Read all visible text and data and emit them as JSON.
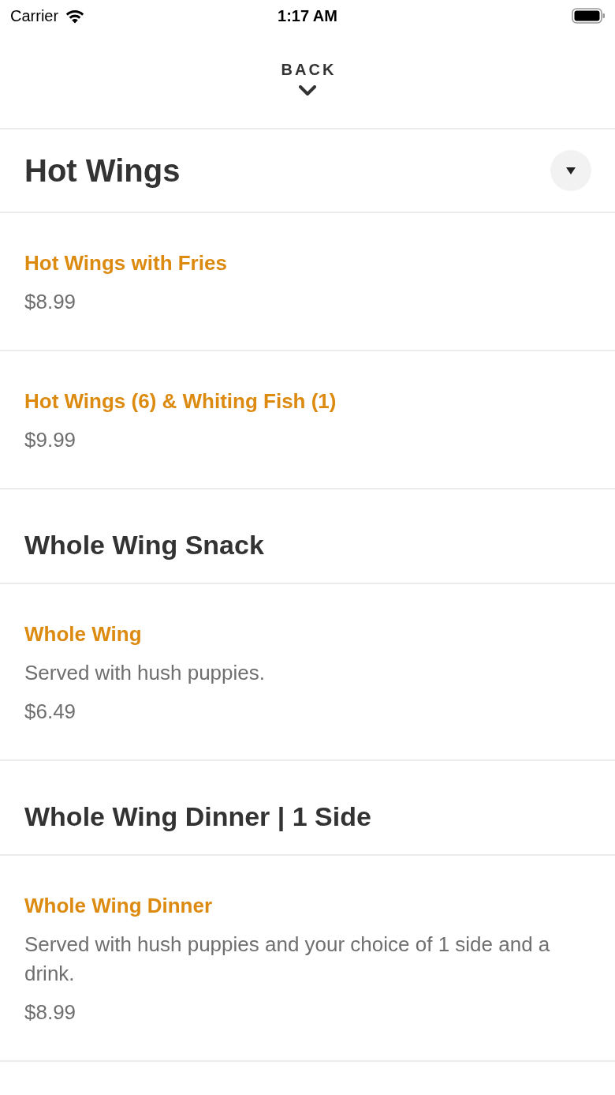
{
  "status_bar": {
    "carrier": "Carrier",
    "time": "1:17 AM"
  },
  "header": {
    "back_label": "BACK"
  },
  "current_category": {
    "title": "Hot Wings"
  },
  "sections": [
    {
      "items": [
        {
          "name": "Hot Wings with Fries",
          "price": "$8.99"
        },
        {
          "name": "Hot Wings (6) & Whiting Fish (1)",
          "price": "$9.99"
        }
      ]
    },
    {
      "title": "Whole Wing Snack",
      "items": [
        {
          "name": "Whole Wing",
          "description": "Served with hush puppies.",
          "price": "$6.49"
        }
      ]
    },
    {
      "title": "Whole Wing Dinner | 1 Side",
      "items": [
        {
          "name": "Whole Wing Dinner",
          "description": "Served with hush puppies and your choice of 1 side and a drink.",
          "price": "$8.99"
        }
      ]
    }
  ]
}
